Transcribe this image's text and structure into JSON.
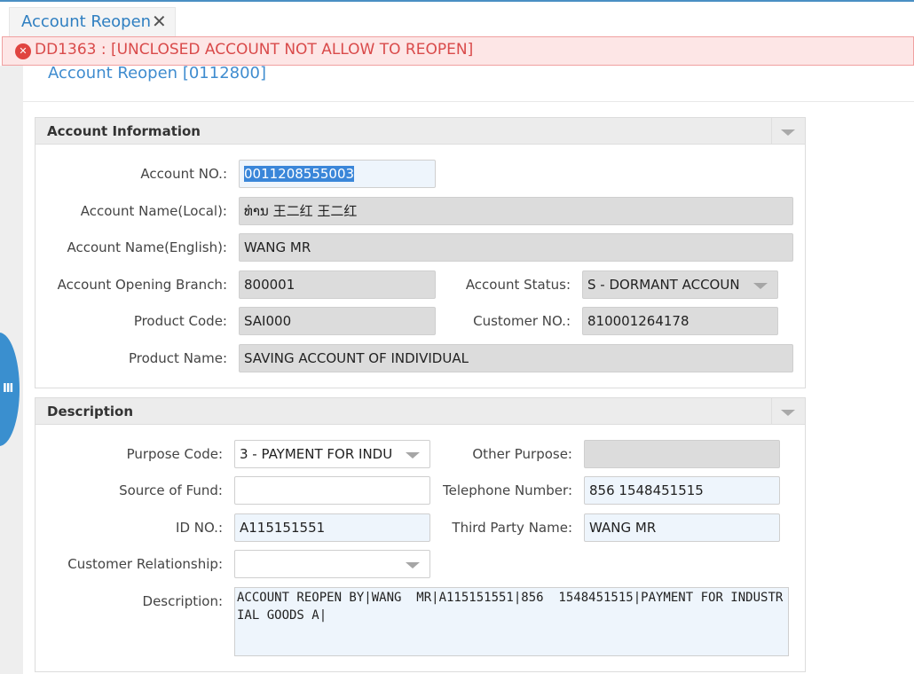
{
  "tab": {
    "title": "Account Reopen",
    "close_glyph": "✕"
  },
  "error": {
    "icon": "error-icon",
    "icon_glyph": "✕",
    "message": "DD1363 : [UNCLOSED ACCOUNT NOT ALLOW TO REOPEN]"
  },
  "page": {
    "title": "Account Reopen [0112800]"
  },
  "sidebar_handle": {
    "icon": "menu-lines-icon",
    "glyph": "Ⅲ"
  },
  "account_info": {
    "title": "Account Information",
    "account_no": {
      "label": "Account NO.:",
      "value": "0011208555003"
    },
    "name_local": {
      "label": "Account Name(Local):",
      "value": "ທ່ານ 王二红 王二红"
    },
    "name_english": {
      "label": "Account Name(English):",
      "value": "WANG  MR"
    },
    "opening_branch": {
      "label": "Account Opening Branch:",
      "value": "800001"
    },
    "account_status": {
      "label": "Account Status:",
      "value": "S - DORMANT ACCOUN"
    },
    "product_code": {
      "label": "Product Code:",
      "value": "SAI000"
    },
    "customer_no": {
      "label": "Customer NO.:",
      "value": "810001264178"
    },
    "product_name": {
      "label": "Product Name:",
      "value": "SAVING ACCOUNT OF INDIVIDUAL"
    }
  },
  "description": {
    "title": "Description",
    "purpose_code": {
      "label": "Purpose Code:",
      "value": "3 - PAYMENT FOR INDU"
    },
    "other_purpose": {
      "label": "Other Purpose:",
      "value": ""
    },
    "source_of_fund": {
      "label": "Source of Fund:",
      "value": ""
    },
    "telephone": {
      "label": "Telephone Number:",
      "value": "856  1548451515"
    },
    "id_no": {
      "label": "ID NO.:",
      "value": "A115151551"
    },
    "third_party": {
      "label": "Third Party Name:",
      "value": "WANG  MR"
    },
    "customer_relationship": {
      "label": "Customer Relationship:",
      "value": ""
    },
    "desc": {
      "label": "Description:",
      "value": "ACCOUNT REOPEN BY|WANG  MR|A115151551|856  1548451515|PAYMENT FOR INDUSTRIAL GOODS A|"
    }
  },
  "colors": {
    "accent": "#3f8ccf",
    "error_bg": "#fde6e6",
    "error_text": "#d94a4a",
    "readonly_bg": "#dcdcdc",
    "editable_bg": "#eef5fc"
  }
}
